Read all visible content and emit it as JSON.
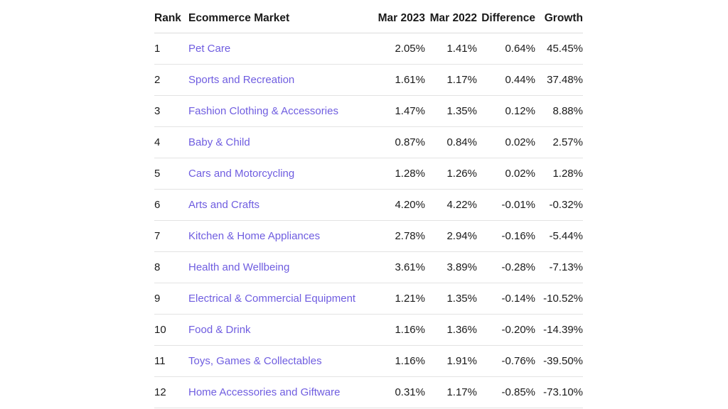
{
  "table": {
    "columns": [
      {
        "key": "rank",
        "label": "Rank"
      },
      {
        "key": "market",
        "label": "Ecommerce Market"
      },
      {
        "key": "y2023",
        "label": "Mar 2023"
      },
      {
        "key": "y2022",
        "label": "Mar 2022"
      },
      {
        "key": "diff",
        "label": "Difference"
      },
      {
        "key": "growth",
        "label": "Growth"
      }
    ],
    "colors": {
      "link": "#6f5de0",
      "positive": "#3c7d45",
      "negative": "#d0342c",
      "rule": "#e3e3e3",
      "header_rule": "#dcdcdc",
      "text": "#1a1a1a",
      "background": "#ffffff"
    },
    "rows": [
      {
        "rank": "1",
        "market": "Pet Care",
        "y2023": "2.05%",
        "y2022": "1.41%",
        "diff": "0.64%",
        "growth": "45.45%",
        "sign": "pos"
      },
      {
        "rank": "2",
        "market": "Sports and Recreation",
        "y2023": "1.61%",
        "y2022": "1.17%",
        "diff": "0.44%",
        "growth": "37.48%",
        "sign": "pos"
      },
      {
        "rank": "3",
        "market": "Fashion Clothing & Accessories",
        "y2023": "1.47%",
        "y2022": "1.35%",
        "diff": "0.12%",
        "growth": "8.88%",
        "sign": "pos"
      },
      {
        "rank": "4",
        "market": "Baby & Child",
        "y2023": "0.87%",
        "y2022": "0.84%",
        "diff": "0.02%",
        "growth": "2.57%",
        "sign": "pos"
      },
      {
        "rank": "5",
        "market": "Cars and Motorcycling",
        "y2023": "1.28%",
        "y2022": "1.26%",
        "diff": "0.02%",
        "growth": "1.28%",
        "sign": "pos"
      },
      {
        "rank": "6",
        "market": "Arts and Crafts",
        "y2023": "4.20%",
        "y2022": "4.22%",
        "diff": "-0.01%",
        "growth": "-0.32%",
        "sign": "neg"
      },
      {
        "rank": "7",
        "market": "Kitchen & Home Appliances",
        "y2023": "2.78%",
        "y2022": "2.94%",
        "diff": "-0.16%",
        "growth": "-5.44%",
        "sign": "neg"
      },
      {
        "rank": "8",
        "market": "Health and Wellbeing",
        "y2023": "3.61%",
        "y2022": "3.89%",
        "diff": "-0.28%",
        "growth": "-7.13%",
        "sign": "neg"
      },
      {
        "rank": "9",
        "market": "Electrical & Commercial Equipment",
        "y2023": "1.21%",
        "y2022": "1.35%",
        "diff": "-0.14%",
        "growth": "-10.52%",
        "sign": "neg"
      },
      {
        "rank": "10",
        "market": "Food & Drink",
        "y2023": "1.16%",
        "y2022": "1.36%",
        "diff": "-0.20%",
        "growth": "-14.39%",
        "sign": "neg"
      },
      {
        "rank": "11",
        "market": "Toys, Games & Collectables",
        "y2023": "1.16%",
        "y2022": "1.91%",
        "diff": "-0.76%",
        "growth": "-39.50%",
        "sign": "neg"
      },
      {
        "rank": "12",
        "market": "Home Accessories and Giftware",
        "y2023": "0.31%",
        "y2022": "1.17%",
        "diff": "-0.85%",
        "growth": "-73.10%",
        "sign": "neg"
      }
    ]
  },
  "chart_data": {
    "type": "table",
    "title": "",
    "categories": [
      "Pet Care",
      "Sports and Recreation",
      "Fashion Clothing & Accessories",
      "Baby & Child",
      "Cars and Motorcycling",
      "Arts and Crafts",
      "Kitchen & Home Appliances",
      "Health and Wellbeing",
      "Electrical & Commercial Equipment",
      "Food & Drink",
      "Toys, Games & Collectables",
      "Home Accessories and Giftware"
    ],
    "series": [
      {
        "name": "Mar 2023",
        "values": [
          2.05,
          1.61,
          1.47,
          0.87,
          1.28,
          4.2,
          2.78,
          3.61,
          1.21,
          1.16,
          1.16,
          0.31
        ]
      },
      {
        "name": "Mar 2022",
        "values": [
          1.41,
          1.17,
          1.35,
          0.84,
          1.26,
          4.22,
          2.94,
          3.89,
          1.35,
          1.36,
          1.91,
          1.17
        ]
      },
      {
        "name": "Difference",
        "values": [
          0.64,
          0.44,
          0.12,
          0.02,
          0.02,
          -0.01,
          -0.16,
          -0.28,
          -0.14,
          -0.2,
          -0.76,
          -0.85
        ]
      },
      {
        "name": "Growth",
        "values": [
          45.45,
          37.48,
          8.88,
          2.57,
          1.28,
          -0.32,
          -5.44,
          -7.13,
          -10.52,
          -14.39,
          -39.5,
          -73.1
        ]
      }
    ],
    "ranks": [
      1,
      2,
      3,
      4,
      5,
      6,
      7,
      8,
      9,
      10,
      11,
      12
    ],
    "units": "percent",
    "legend": "none",
    "grid": false
  }
}
